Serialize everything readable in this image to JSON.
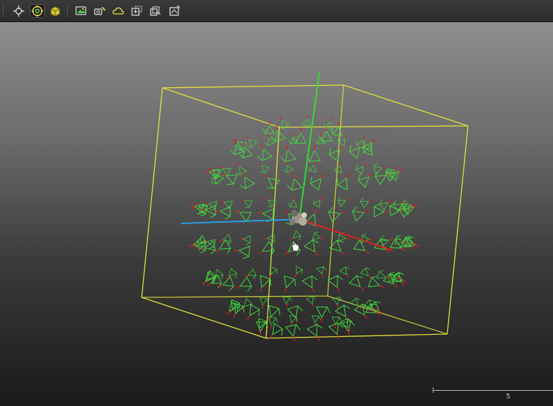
{
  "toolbar": {
    "buttons": [
      {
        "icon": "pan-icon"
      },
      {
        "icon": "target-icon",
        "active": true
      },
      {
        "icon": "cube-icon"
      },
      {
        "icon": "render-view-icon"
      },
      {
        "icon": "camera-refresh-icon"
      },
      {
        "icon": "cloud-icon"
      },
      {
        "icon": "render-region-icon"
      },
      {
        "icon": "render-sequence-icon"
      },
      {
        "icon": "snapshot-icon"
      }
    ]
  },
  "timeline": {
    "frame_label": "5"
  },
  "colors": {
    "bounding_box": "#e8e53a",
    "camera_frustum": "#3fe03f",
    "camera_direction": "#e02020",
    "axis_y": "#33dd33",
    "axis_x": "#dd2222",
    "axis_z": "#2a9fe8",
    "accent": "#f0e24a"
  }
}
